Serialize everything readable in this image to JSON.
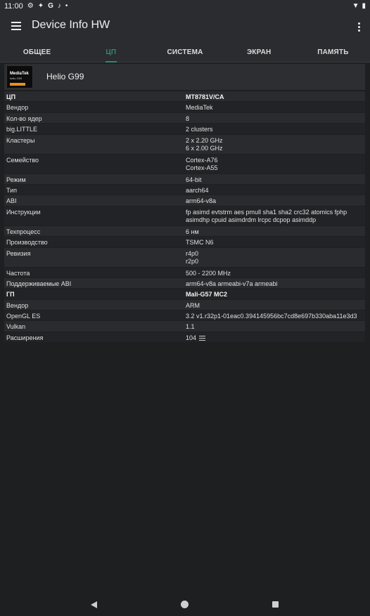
{
  "status_bar": {
    "time": "11:00",
    "icons_left": [
      "settings-icon",
      "notification-icon",
      "google-icon",
      "mic-icon",
      "dot-icon"
    ],
    "icons_right": [
      "wifi-icon",
      "battery-icon"
    ]
  },
  "app_bar": {
    "title": "Device Info HW"
  },
  "tabs": [
    {
      "label": "ОБЩЕЕ",
      "active": false
    },
    {
      "label": "ЦП",
      "active": true
    },
    {
      "label": "СИСТЕМА",
      "active": false
    },
    {
      "label": "ЭКРАН",
      "active": false
    },
    {
      "label": "ПАМЯТЬ",
      "active": false
    }
  ],
  "chip": {
    "logo_brand": "MediaTek",
    "logo_model": "helio G99",
    "name": "Helio G99"
  },
  "rows": [
    {
      "key": "ЦП",
      "value": "MT8781V/CA",
      "section": true,
      "lines": 1
    },
    {
      "key": "Вендор",
      "value": "MediaTek",
      "lines": 1
    },
    {
      "key": "Кол-во ядер",
      "value": "8",
      "lines": 1
    },
    {
      "key": "big.LITTLE",
      "value": "2 clusters",
      "lines": 1
    },
    {
      "key": "Кластеры",
      "value": "2 x 2.20 GHz\n6 x 2.00 GHz",
      "lines": 2
    },
    {
      "key": "Семейство",
      "value": "Cortex-A76\nCortex-A55",
      "lines": 2
    },
    {
      "key": "Режим",
      "value": "64-bit",
      "lines": 1
    },
    {
      "key": "Тип",
      "value": "aarch64",
      "lines": 1
    },
    {
      "key": "ABI",
      "value": "arm64-v8a",
      "lines": 1
    },
    {
      "key": "Инструкции",
      "value": "fp asimd evtstrm aes pmull sha1 sha2 crc32 atomics fphp\nasimdhp cpuid asimdrdm lrcpc dcpop asimddp",
      "lines": 2
    },
    {
      "key": "Техпроцесс",
      "value": "6 нм",
      "lines": 1
    },
    {
      "key": "Производство",
      "value": "TSMC N6",
      "lines": 1
    },
    {
      "key": "Ревизия",
      "value": "r4p0\nr2p0",
      "lines": 2
    },
    {
      "key": "Частота",
      "value": "500 - 2200 MHz",
      "lines": 1
    },
    {
      "key": "Поддерживаемые ABI",
      "value": "arm64-v8a armeabi-v7a armeabi",
      "lines": 1
    },
    {
      "key": "ГП",
      "value": "Mali-G57 MC2",
      "section": true,
      "lines": 1
    },
    {
      "key": "Вендор",
      "value": "ARM",
      "lines": 1
    },
    {
      "key": "OpenGL ES",
      "value": "3.2 v1.r32p1-01eac0.394145956bc7cd8e697b330aba11e3d3",
      "lines": 1
    },
    {
      "key": "Vulkan",
      "value": "1.1",
      "lines": 1
    },
    {
      "key": "Расширения",
      "value": "104",
      "lines": 1,
      "icon": "list-icon"
    }
  ],
  "nav_bar": {
    "buttons": [
      "back-icon",
      "home-icon",
      "recents-icon"
    ]
  }
}
